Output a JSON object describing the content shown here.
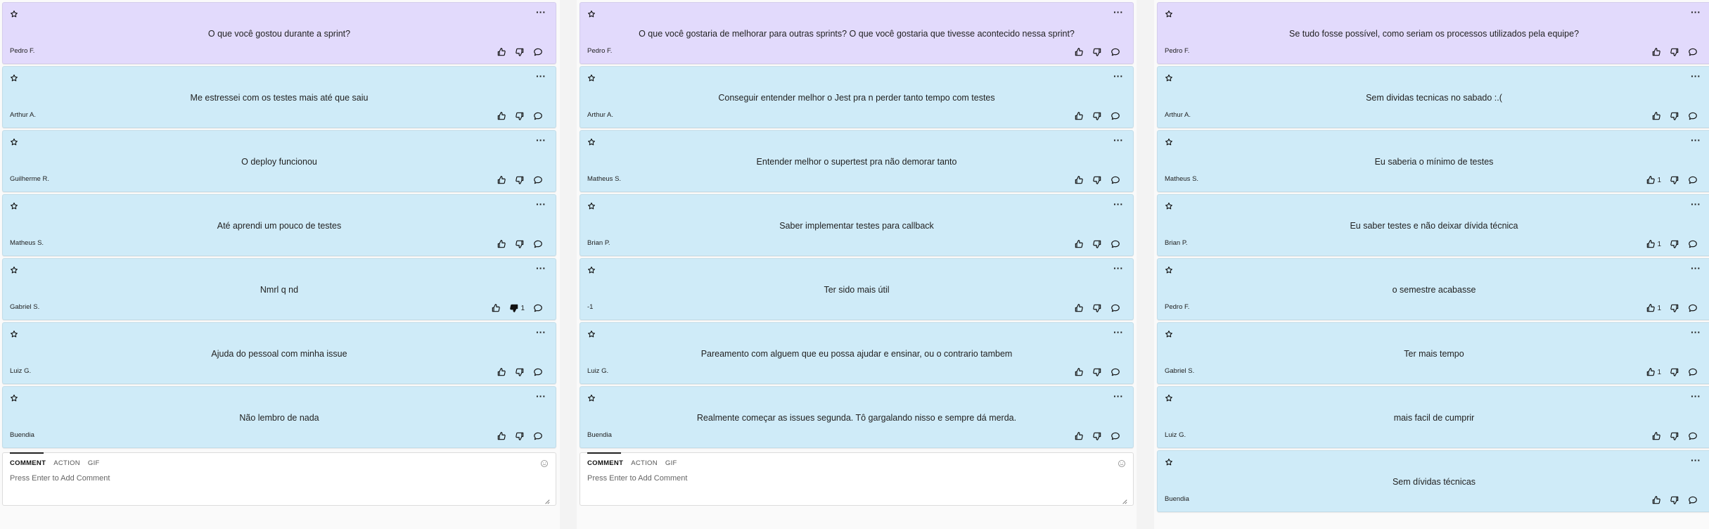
{
  "columns": [
    {
      "header": {
        "text": "O que você gostou durante a sprint?",
        "author": "Pedro F.",
        "up": "",
        "down": ""
      },
      "cards": [
        {
          "text": "Me estressei com os testes mais até que saiu",
          "author": "Arthur A.",
          "up": "",
          "down": "",
          "down_active": false
        },
        {
          "text": "O deploy funcionou",
          "author": "Guilherme R.",
          "up": "",
          "down": "",
          "down_active": false
        },
        {
          "text": "Até aprendi um pouco de testes",
          "author": "Matheus S.",
          "up": "",
          "down": "",
          "down_active": false
        },
        {
          "text": "Nmrl q nd",
          "author": "Gabriel S.",
          "up": "",
          "down": "1",
          "down_active": true
        },
        {
          "text": "Ajuda do pessoal com minha issue",
          "author": "Luiz G.",
          "up": "",
          "down": "",
          "down_active": false
        },
        {
          "text": "Não lembro de nada",
          "author": "Buendia",
          "up": "",
          "down": "",
          "down_active": false
        }
      ],
      "comment": {
        "tabs": [
          "COMMENT",
          "ACTION",
          "GIF"
        ],
        "placeholder": "Press Enter to Add Comment"
      }
    },
    {
      "header": {
        "text": "O que você gostaria de melhorar para outras sprints? O que você gostaria que tivesse acontecido nessa sprint?",
        "author": "Pedro F.",
        "up": "",
        "down": ""
      },
      "cards": [
        {
          "text": "Conseguir entender melhor o Jest pra n perder tanto tempo com testes",
          "author": "Arthur A.",
          "up": "",
          "down": "",
          "down_active": false
        },
        {
          "text": "Entender melhor o supertest pra não demorar tanto",
          "author": "Matheus S.",
          "up": "",
          "down": "",
          "down_active": false
        },
        {
          "text": "Saber implementar testes para callback",
          "author": "Brian P.",
          "up": "",
          "down": "",
          "down_active": false
        },
        {
          "text": "Ter sido mais útil",
          "author": "-1",
          "up": "",
          "down": "",
          "down_active": false
        },
        {
          "text": "Pareamento com alguem que eu possa ajudar e ensinar, ou o contrario tambem",
          "author": "Luiz G.",
          "up": "",
          "down": "",
          "down_active": false
        },
        {
          "text": "Realmente começar as issues segunda. Tô gargalando nisso e sempre dá merda.",
          "author": "Buendia",
          "up": "",
          "down": "",
          "down_active": false
        }
      ],
      "comment": {
        "tabs": [
          "COMMENT",
          "ACTION",
          "GIF"
        ],
        "placeholder": "Press Enter to Add Comment"
      }
    },
    {
      "header": {
        "text": "Se tudo fosse possível, como seriam os processos utilizados pela equipe?",
        "author": "Pedro F.",
        "up": "",
        "down": ""
      },
      "cards": [
        {
          "text": "Sem dividas tecnicas no sabado :.(",
          "author": "Arthur A.",
          "up": "",
          "down": "",
          "down_active": false
        },
        {
          "text": "Eu saberia o mínimo de testes",
          "author": "Matheus S.",
          "up": "1",
          "down": "",
          "down_active": false
        },
        {
          "text": "Eu saber testes e não deixar dívida técnica",
          "author": "Brian P.",
          "up": "1",
          "down": "",
          "down_active": false
        },
        {
          "text": "o semestre acabasse",
          "author": "Pedro F.",
          "up": "1",
          "down": "",
          "down_active": false
        },
        {
          "text": "Ter mais tempo",
          "author": "Gabriel S.",
          "up": "1",
          "down": "",
          "down_active": false
        },
        {
          "text": "mais facil de cumprir",
          "author": "Luiz G.",
          "up": "",
          "down": "",
          "down_active": false
        },
        {
          "text": "Sem dívidas técnicas",
          "author": "Buendia",
          "up": "",
          "down": "",
          "down_active": false
        }
      ],
      "comment": null
    }
  ],
  "colors": {
    "header_card": "#e2dafc",
    "note_card": "#cfebf8"
  },
  "icons": [
    "star-icon",
    "more-icon",
    "thumbs-up-icon",
    "thumbs-down-icon",
    "comment-icon",
    "emoji-icon"
  ]
}
